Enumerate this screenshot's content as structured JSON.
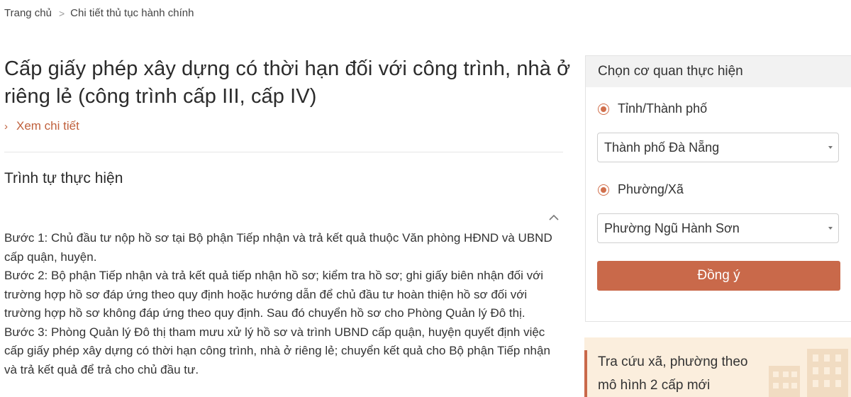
{
  "breadcrumb": {
    "home": "Trang chủ",
    "separator": ">",
    "current": "Chi tiết thủ tục hành chính"
  },
  "title": "Cấp giấy phép xây dựng có thời hạn đối với công trình, nhà ở riêng lẻ (công trình cấp III, cấp IV)",
  "detail_link": "Xem chi tiết",
  "section": {
    "title": "Trình tự thực hiện",
    "steps": [
      "Bước 1: Chủ đầu tư nộp hồ sơ tại Bộ phận Tiếp nhận và trả kết quả thuộc Văn phòng HĐND và UBND cấp quận, huyện.",
      "Bước 2: Bộ phận Tiếp nhận và trả kết quả tiếp nhận hồ sơ; kiểm tra hồ sơ; ghi giấy biên nhận đối với trường hợp hồ sơ đáp ứng theo quy định hoặc hướng dẫn để chủ đầu tư hoàn thiện hồ sơ đối với trường hợp hồ sơ không đáp ứng theo quy định. Sau đó chuyển hồ sơ cho Phòng Quản lý Đô thị.",
      "Bước 3: Phòng Quản lý Đô thị tham mưu xử lý hồ sơ và trình UBND cấp quận, huyện quyết định việc cấp giấy phép xây dựng có thời hạn công trình, nhà ở riêng lẻ; chuyển kết quả cho Bộ phận Tiếp nhận và trả kết quả để trả cho chủ đầu tư."
    ]
  },
  "panel": {
    "header": "Chọn cơ quan thực hiện",
    "province_label": "Tỉnh/Thành phố",
    "province_value": "Thành phố Đà Nẵng",
    "ward_label": "Phường/Xã",
    "ward_value": "Phường Ngũ Hành Sơn",
    "submit": "Đồng ý"
  },
  "promo": {
    "line1": "Tra cứu xã, phường theo",
    "line2": "mô hình 2 cấp mới"
  },
  "colors": {
    "accent": "#c9694a",
    "link": "#c0613d",
    "promo_bg": "#fbeedd",
    "panel_header_bg": "#f2f2f2"
  },
  "icons": {
    "breadcrumb_sep": "chevron-right-icon",
    "detail": "chevron-right-icon",
    "collapse": "chevron-up-icon",
    "select": "caret-down-icon",
    "promo": "building-icon"
  }
}
